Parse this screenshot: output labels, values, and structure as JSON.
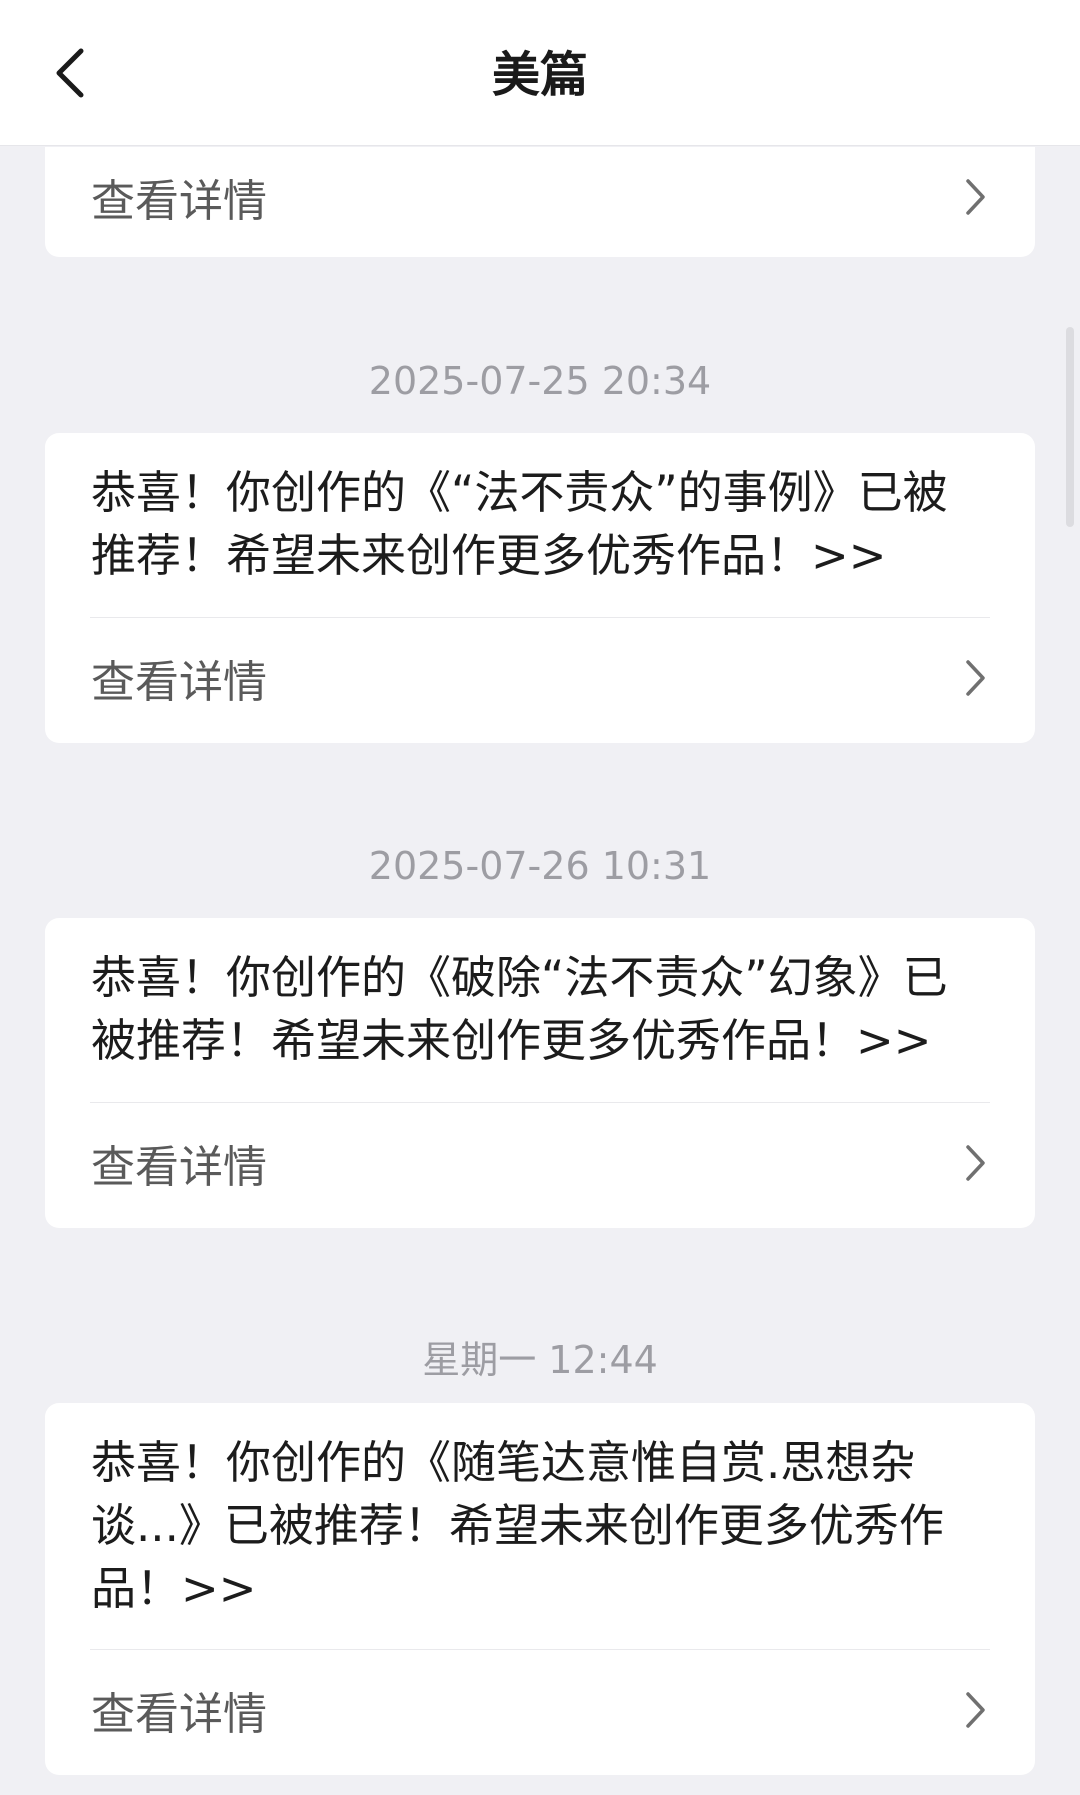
{
  "header": {
    "title": "美篇"
  },
  "detail_label": "查看详情",
  "messages": [
    {
      "time": "2025-07-25 20:34",
      "text": "恭喜！你创作的《“法不责众”的事例》已被推荐！希望未来创作更多优秀作品！>>"
    },
    {
      "time": "2025-07-26 10:31",
      "text": "恭喜！你创作的《破除“法不责众”幻象》已被推荐！希望未来创作更多优秀作品！>>"
    },
    {
      "time": "星期一 12:44",
      "text": "恭喜！你创作的《随笔达意惟自赏.思想杂谈...》已被推荐！希望未来创作更多优秀作品！>>"
    }
  ]
}
